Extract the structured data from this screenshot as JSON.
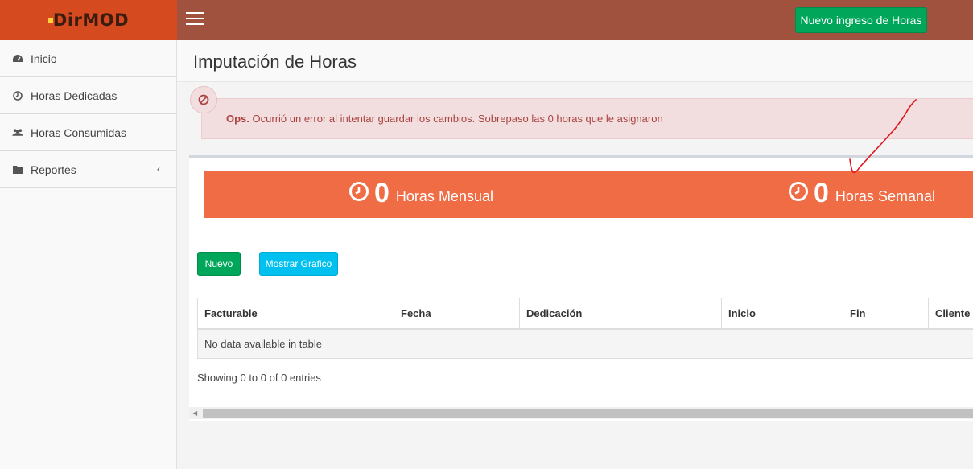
{
  "brand": {
    "logo_text": "DirMOD"
  },
  "header": {
    "new_hours_button": "Nuevo ingreso de Horas"
  },
  "sidebar": {
    "items": [
      {
        "label": "Inicio",
        "icon": "dashboard-icon"
      },
      {
        "label": "Horas Dedicadas",
        "icon": "clock-icon"
      },
      {
        "label": "Horas Consumidas",
        "icon": "users-icon"
      },
      {
        "label": "Reportes",
        "icon": "folder-icon",
        "arrow": "‹"
      }
    ]
  },
  "page": {
    "title": "Imputación de Horas"
  },
  "alert": {
    "title": "Ops.",
    "message": " Ocurrió un error al intentar guardar los cambios. Sobrepaso las 0 horas que le asignaron"
  },
  "stats": {
    "monthly": {
      "value": "0",
      "label": "Horas Mensual"
    },
    "weekly": {
      "value": "0",
      "label": "Horas Semanal"
    }
  },
  "actions": {
    "new_label": "Nuevo",
    "chart_label": "Mostrar Grafico"
  },
  "table": {
    "columns": [
      "Facturable",
      "Fecha",
      "Dedicación",
      "Inicio",
      "Fin",
      "Cliente"
    ],
    "empty": "No data available in table",
    "info": "Showing 0 to 0 of 0 entries"
  },
  "colors": {
    "accent": "#ef6c45",
    "topbar": "#a0523f",
    "logo_bg": "#d54a1f",
    "success": "#00a65a",
    "info": "#00c0ef",
    "danger_bg": "#f2dede",
    "danger_text": "#a94442"
  }
}
